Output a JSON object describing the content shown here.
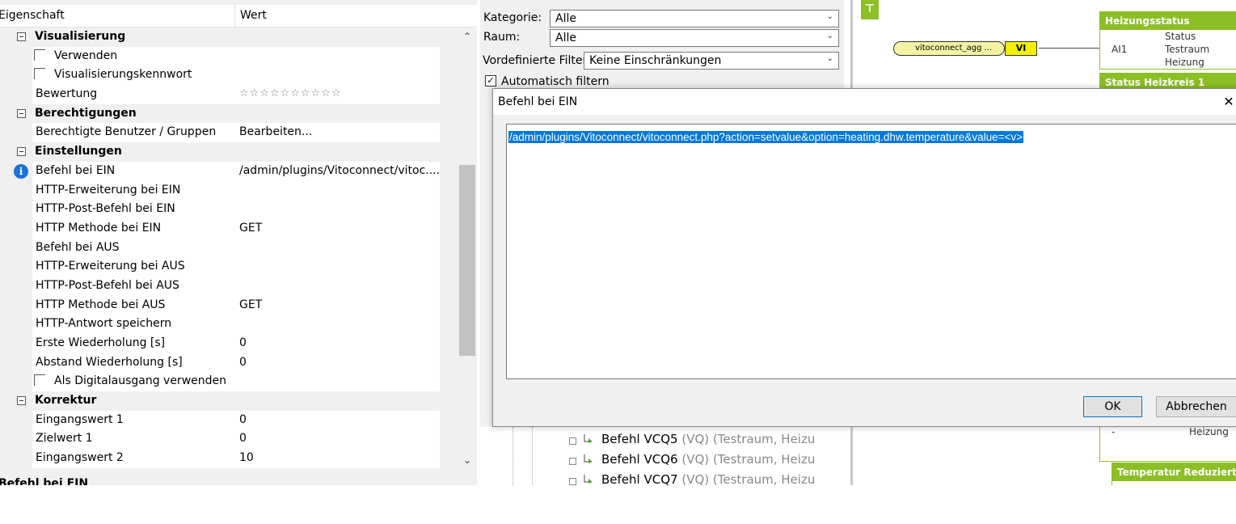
{
  "properties": {
    "header": {
      "col_property": "Eigenschaft",
      "col_value": "Wert"
    },
    "groups": {
      "visualisierung": "Visualisierung",
      "berechtigungen": "Berechtigungen",
      "einstellungen": "Einstellungen",
      "korrektur": "Korrektur"
    },
    "rows": {
      "verwenden": {
        "label": "Verwenden",
        "value": ""
      },
      "vis_kennwort": {
        "label": "Visualisierungskennwort",
        "value": ""
      },
      "bewertung": {
        "label": "Bewertung",
        "value": "☆☆☆☆☆☆☆☆☆☆"
      },
      "berechtigte": {
        "label": "Berechtigte Benutzer / Gruppen",
        "value": "Bearbeiten..."
      },
      "befehl_ein": {
        "label": "Befehl bei EIN",
        "value": "/admin/plugins/Vitoconnect/vitoc...."
      },
      "http_erw_ein": {
        "label": "HTTP-Erweiterung bei EIN",
        "value": ""
      },
      "http_post_ein": {
        "label": "HTTP-Post-Befehl bei EIN",
        "value": ""
      },
      "http_methode_ein": {
        "label": "HTTP Methode bei EIN",
        "value": "GET"
      },
      "befehl_aus": {
        "label": "Befehl bei AUS",
        "value": ""
      },
      "http_erw_aus": {
        "label": "HTTP-Erweiterung bei AUS",
        "value": ""
      },
      "http_post_aus": {
        "label": "HTTP-Post-Befehl bei AUS",
        "value": ""
      },
      "http_methode_aus": {
        "label": "HTTP Methode bei AUS",
        "value": "GET"
      },
      "http_antwort": {
        "label": "HTTP-Antwort speichern",
        "value": ""
      },
      "erste_wdh": {
        "label": "Erste Wiederholung [s]",
        "value": "0"
      },
      "abstand_wdh": {
        "label": "Abstand Wiederholung [s]",
        "value": "0"
      },
      "digitalausgang": {
        "label": "Als Digitalausgang verwenden",
        "value": ""
      },
      "eingangswert1": {
        "label": "Eingangswert 1",
        "value": "0"
      },
      "zielwert1": {
        "label": "Zielwert 1",
        "value": "0"
      },
      "eingangswert2": {
        "label": "Eingangswert 2",
        "value": "10"
      }
    },
    "footer_title": "Befehl bei EIN"
  },
  "filter": {
    "kategorie_label": "Kategorie:",
    "kategorie_value": "Alle",
    "raum_label": "Raum:",
    "raum_value": "Alle",
    "vordefiniert_label": "Vordefinierte Filter",
    "vordefiniert_value": "Keine Einschränkungen",
    "auto_filter_label": "Automatisch filtern",
    "auto_filter_checked": true
  },
  "tree": {
    "items": [
      {
        "name": "Befehl VCQ5",
        "detail": "(VQ) (Testraum, Heizu"
      },
      {
        "name": "Befehl VCQ6",
        "detail": "(VQ) (Testraum, Heizu"
      },
      {
        "name": "Befehl VCQ7",
        "detail": "(VQ) (Testraum, Heizu"
      }
    ]
  },
  "canvas": {
    "vito_block": {
      "label": "vitoconnect_agg ...",
      "port": "VI"
    },
    "node_heizungsstatus": {
      "title": "Heizungsstatus",
      "col": "Status",
      "in1": "AI1",
      "room": "Testraum",
      "type": "Heizung"
    },
    "node_heizkreis": {
      "title": "Status Heizkreis 1"
    },
    "node_mid": {
      "in": "-",
      "type": "Heizung"
    },
    "node_temperatur": {
      "title": "Temperatur Reduzierte"
    },
    "colors": {
      "accent": "#8cbf26",
      "selection": "#0078d7"
    }
  },
  "dialog": {
    "title": "Befehl bei EIN",
    "text": "/admin/plugins/Vitoconnect/vitoconnect.php?action=setvalue&option=heating.dhw.temperature&value=<v>",
    "ok": "OK",
    "cancel": "Abbrechen",
    "close_glyph": "✕"
  }
}
